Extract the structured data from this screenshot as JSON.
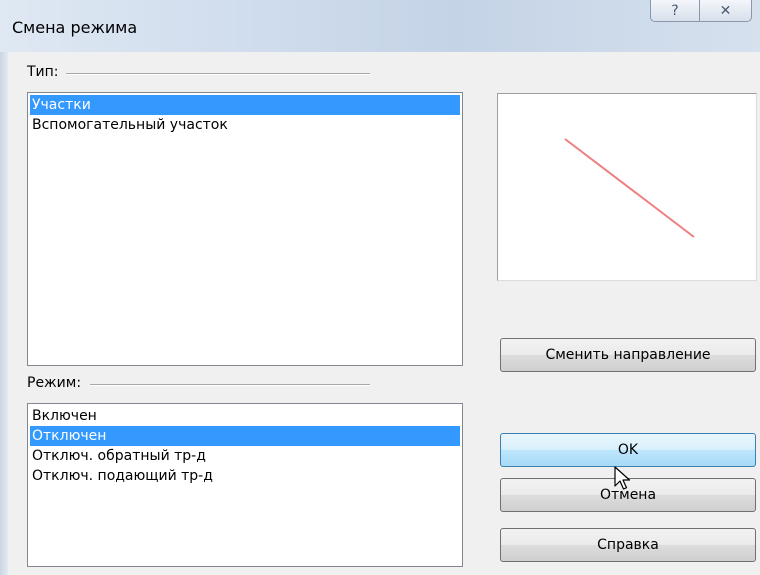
{
  "window": {
    "title": "Смена режима",
    "help_glyph": "?",
    "close_glyph": "✕"
  },
  "type_group": {
    "label": "Тип:",
    "items": [
      {
        "label": "Участки",
        "selected": true
      },
      {
        "label": "Вспомогательный участок",
        "selected": false
      }
    ]
  },
  "mode_group": {
    "label": "Режим:",
    "items": [
      {
        "label": "Включен",
        "selected": false
      },
      {
        "label": "Отключен",
        "selected": true
      },
      {
        "label": "Отключ. обратный тр-д",
        "selected": false
      },
      {
        "label": "Отключ. подающий тр-д",
        "selected": false
      }
    ]
  },
  "preview": {
    "line_color": "#f08080"
  },
  "buttons": {
    "change_direction": "Сменить направление",
    "ok": "OK",
    "cancel": "Отмена",
    "help": "Справка"
  },
  "colors": {
    "selection": "#3399ff",
    "dialog_bg": "#f0f0f0"
  }
}
